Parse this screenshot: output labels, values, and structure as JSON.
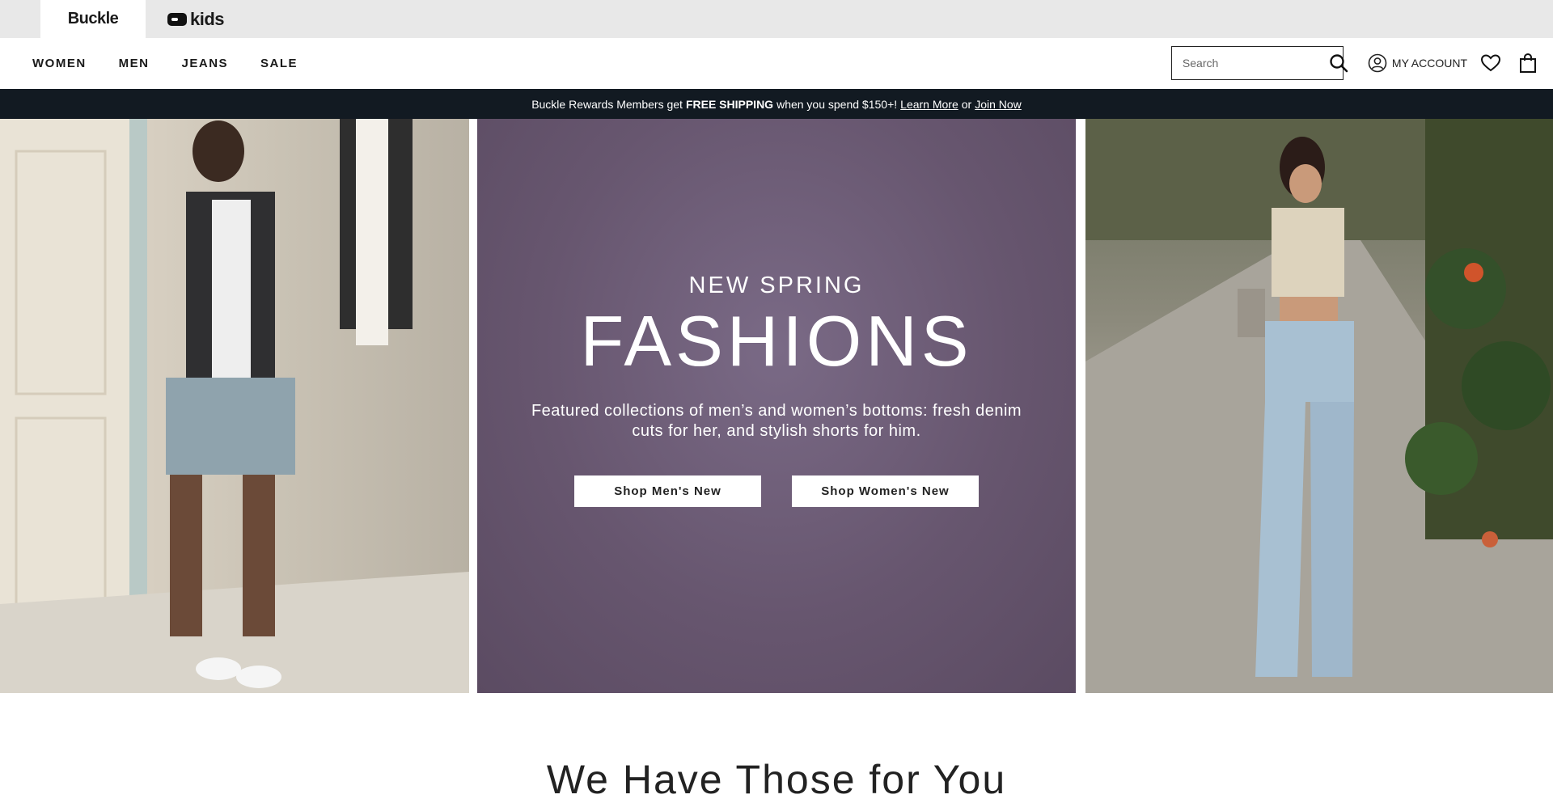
{
  "brands": [
    {
      "label": "Buckle",
      "active": true
    },
    {
      "label": "kids",
      "active": false
    }
  ],
  "nav": {
    "links": [
      "WOMEN",
      "MEN",
      "JEANS",
      "SALE"
    ],
    "search_placeholder": "Search",
    "account_label": "MY ACCOUNT"
  },
  "promo": {
    "prefix": "Buckle Rewards Members get",
    "highlight": "FREE SHIPPING",
    "middle": "when you spend $150+!",
    "learn_more": "Learn More",
    "or": "or",
    "join_now": "Join Now"
  },
  "hero": {
    "kicker": "NEW SPRING",
    "title": "FASHIONS",
    "description": "Featured collections of men’s and women’s bottoms: fresh denim cuts for her, and stylish shorts for him.",
    "buttons": [
      "Shop Men's New",
      "Shop Women's New"
    ],
    "colors": {
      "panel": "#67566f"
    }
  },
  "section": {
    "heading": "We Have Those for You"
  }
}
